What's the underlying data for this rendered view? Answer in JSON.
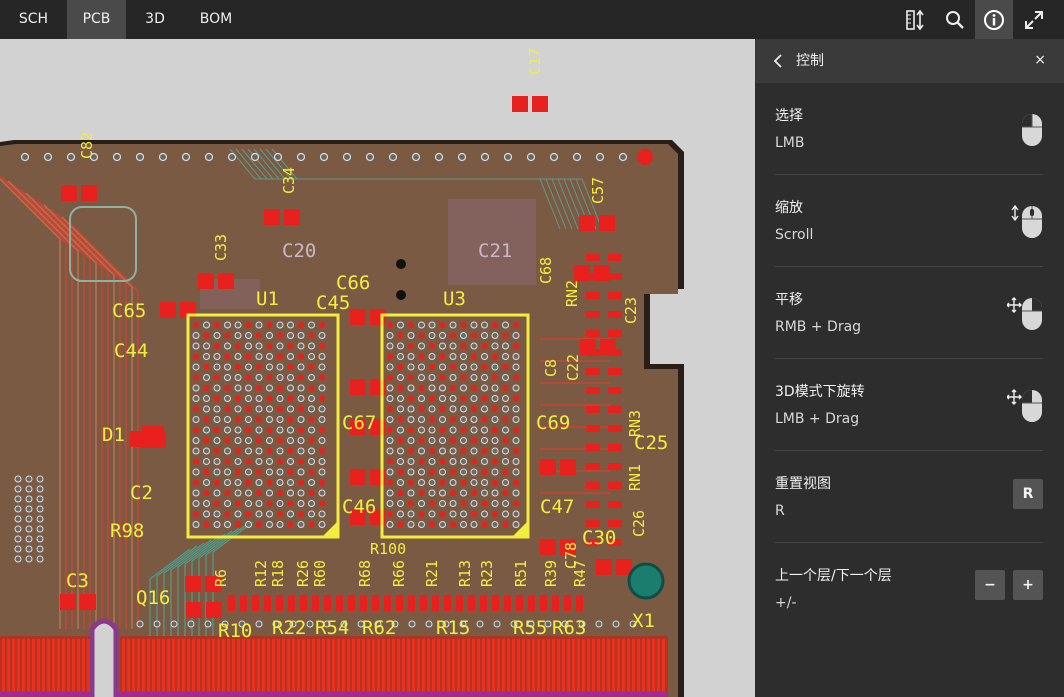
{
  "tabs": [
    {
      "label": "SCH",
      "active": false
    },
    {
      "label": "PCB",
      "active": true
    },
    {
      "label": "3D",
      "active": false
    },
    {
      "label": "BOM",
      "active": false
    }
  ],
  "toolbar": {
    "icons": [
      "ruler-measure-icon",
      "search-icon",
      "info-icon",
      "fullscreen-icon"
    ],
    "active_icon": "info-icon"
  },
  "pcb_labels": {
    "components": [
      "C17",
      "C82",
      "C34",
      "C57",
      "C33",
      "C66",
      "C45",
      "C68",
      "RN2",
      "C23",
      "C65",
      "U1",
      "U3",
      "C44",
      "C8",
      "C22",
      "RN3",
      "D1",
      "C67",
      "C69",
      "C25",
      "RN1",
      "C2",
      "C26",
      "R98",
      "C46",
      "C47",
      "C30",
      "R100",
      "C3",
      "C78",
      "Q16",
      "R6",
      "R12",
      "R18",
      "R26",
      "R60",
      "R68",
      "R66",
      "R21",
      "R13",
      "R23",
      "R51",
      "R39",
      "R47",
      "R10",
      "R22",
      "R54",
      "R62",
      "R15",
      "R55",
      "R63",
      "X1",
      "C20",
      "C21"
    ]
  },
  "panel": {
    "title": "控制",
    "close_label": "×",
    "controls": [
      {
        "label": "选择",
        "key": "LMB",
        "icon": "mouse-left-click-icon"
      },
      {
        "label": "缩放",
        "key": "Scroll",
        "icon": "mouse-scroll-icon"
      },
      {
        "label": "平移",
        "key": "RMB + Drag",
        "icon": "mouse-right-drag-icon"
      },
      {
        "label": "3D模式下旋转",
        "key": "LMB + Drag",
        "icon": "mouse-left-drag-icon"
      },
      {
        "label": "重置视图",
        "key": "R",
        "button": "R"
      },
      {
        "label": "上一个层/下一个层",
        "key": "+/-",
        "buttons": [
          "−",
          "+"
        ]
      }
    ]
  },
  "colors": {
    "topbar": "#262626",
    "active_tab": "#4a4a4a",
    "canvas_bg": "#d2d2d2",
    "board": "#7b5a44",
    "pad": "#e8201e",
    "silk": "#f2ee3e",
    "copper": "#d9442e",
    "panel_bg": "#2d2d2d"
  }
}
